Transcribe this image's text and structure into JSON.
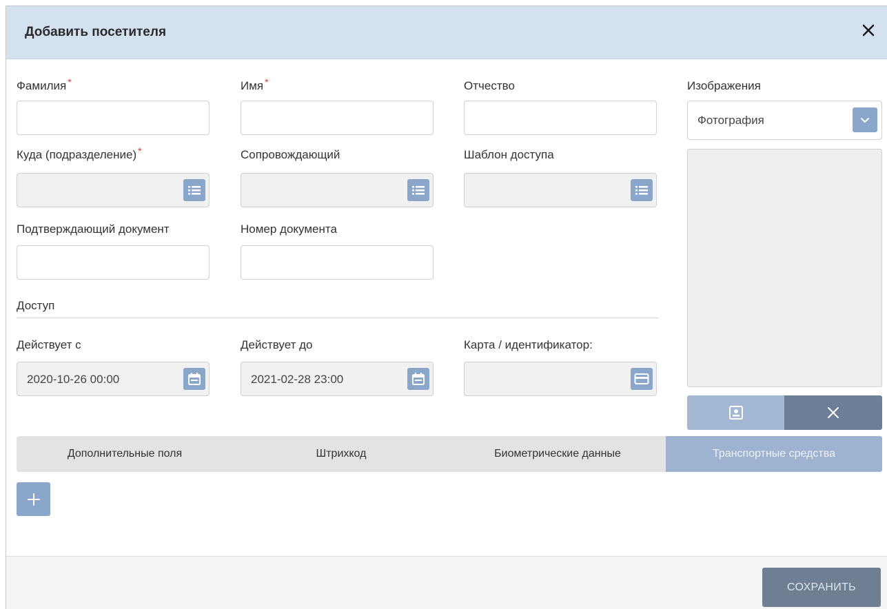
{
  "dialog": {
    "title": "Добавить посетителя"
  },
  "fields": {
    "last_name": {
      "label": "Фамилия",
      "required_mark": "*",
      "value": ""
    },
    "first_name": {
      "label": "Имя",
      "required_mark": "*",
      "value": ""
    },
    "patronymic": {
      "label": "Отчество",
      "value": ""
    },
    "department": {
      "label": "Куда (подразделение)",
      "required_mark": "*",
      "value": ""
    },
    "escort": {
      "label": "Сопровождающий",
      "value": ""
    },
    "access_template": {
      "label": "Шаблон доступа",
      "value": ""
    },
    "document": {
      "label": "Подтверждающий документ",
      "value": ""
    },
    "document_number": {
      "label": "Номер документа",
      "value": ""
    }
  },
  "access": {
    "section_label": "Доступ",
    "valid_from": {
      "label": "Действует с",
      "value": "2020-10-26 00:00"
    },
    "valid_to": {
      "label": "Действует до",
      "value": "2021-02-28 23:00"
    },
    "card": {
      "label": "Карта / идентификатор:",
      "value": ""
    }
  },
  "images": {
    "label": "Изображения",
    "selected": "Фотография"
  },
  "tabs": [
    {
      "label": "Дополнительные поля",
      "active": false
    },
    {
      "label": "Штрихкод",
      "active": false
    },
    {
      "label": "Биометрические данные",
      "active": false
    },
    {
      "label": "Транспортные средства",
      "active": true
    }
  ],
  "footer": {
    "save_label": "СОХРАНИТЬ"
  },
  "colors": {
    "header_bg": "#d4e1ef",
    "accent": "#8aa7cb",
    "active_tab": "#9db3cf",
    "save_button": "#6f7f93",
    "required": "#e53935"
  }
}
